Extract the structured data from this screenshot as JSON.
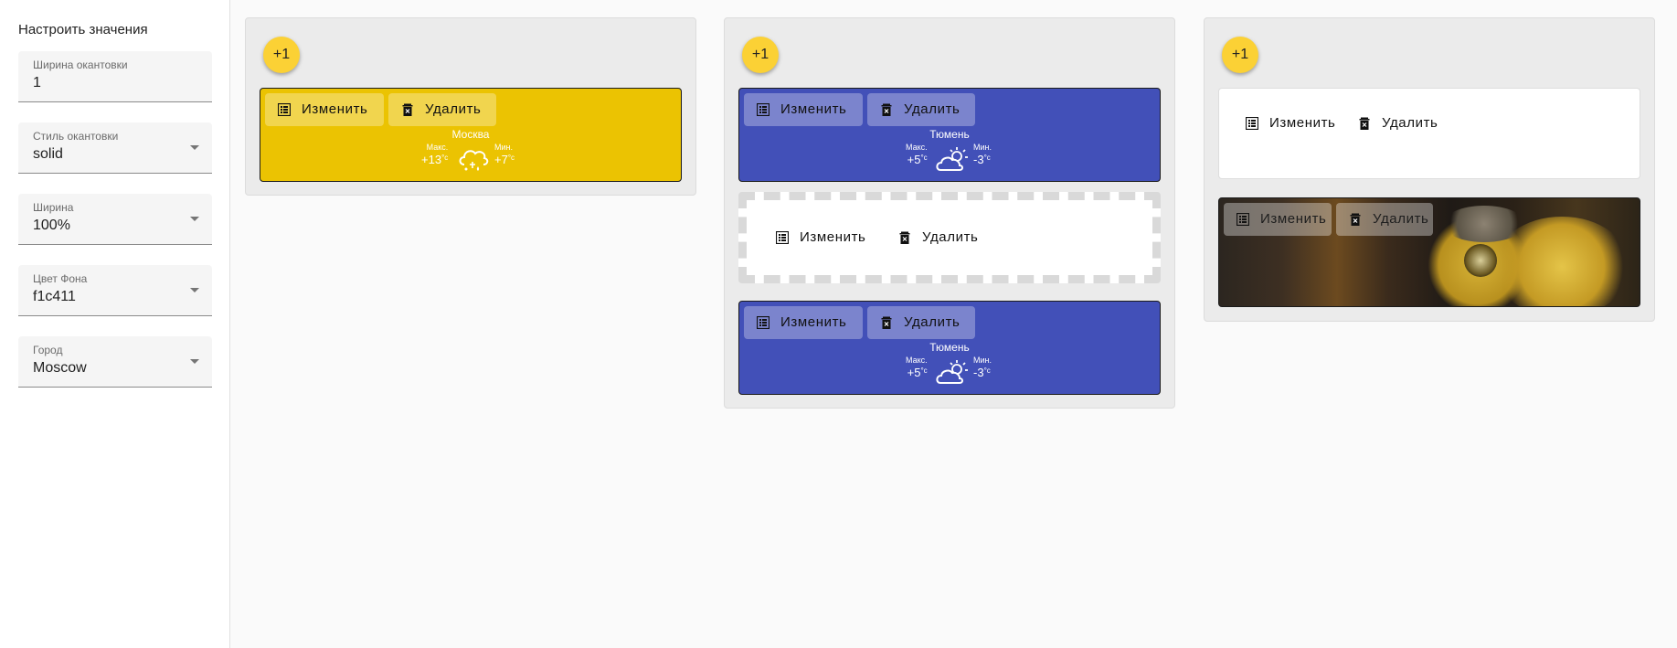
{
  "sidebar": {
    "title": "Настроить значения",
    "fields": [
      {
        "label": "Ширина окантовки",
        "value": "1"
      },
      {
        "label": "Стиль окантовки",
        "value": "solid"
      },
      {
        "label": "Ширина",
        "value": "100%"
      },
      {
        "label": "Цвет Фона",
        "value": "f1c411"
      },
      {
        "label": "Город",
        "value": "Moscow"
      }
    ]
  },
  "fab_label": "+1",
  "buttons": {
    "edit": "Изменить",
    "delete": "Удалить"
  },
  "colors": {
    "yellow": "#ebc302",
    "blue": "#4250b8",
    "fab": "#fbd135"
  },
  "widgets": {
    "moscow": {
      "city": "Москва",
      "max_label": "Макс.",
      "max_temp": "+13",
      "min_label": "Мин.",
      "min_temp": "+7",
      "unit": "°c",
      "icon": "rain-snow-cloud-icon"
    },
    "tyumen_1": {
      "city": "Тюмень",
      "max_label": "Макс.",
      "max_temp": "+5",
      "min_label": "Мин.",
      "min_temp": "-3",
      "unit": "°c",
      "icon": "partly-sunny-cloud-icon"
    },
    "tyumen_2": {
      "city": "Тюмень",
      "max_label": "Макс.",
      "max_temp": "+5",
      "min_label": "Мин.",
      "min_temp": "-3",
      "unit": "°c",
      "icon": "partly-sunny-cloud-icon"
    }
  }
}
